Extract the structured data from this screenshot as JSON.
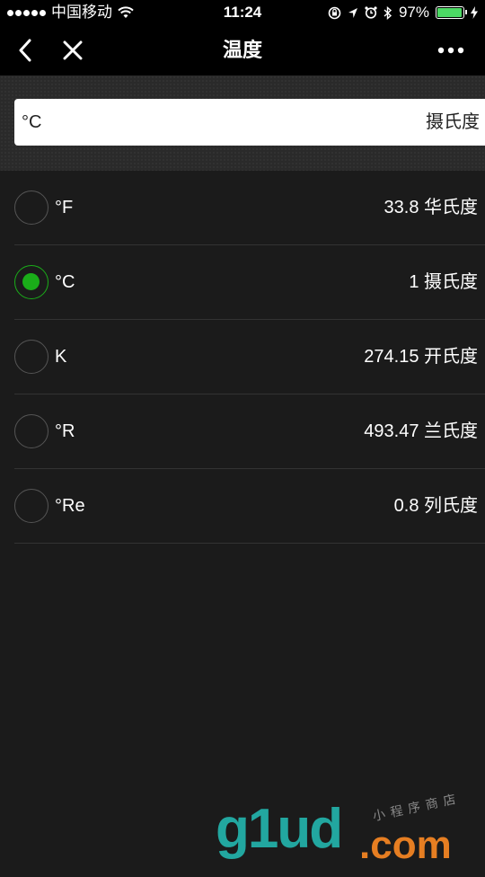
{
  "status_bar": {
    "carrier": "中国移动",
    "time": "11:24",
    "battery": "97%",
    "battery_level": 0.97,
    "icons": [
      "signal-dots-icon",
      "wifi-icon",
      "orientation-lock-icon",
      "location-icon",
      "alarm-icon",
      "bluetooth-icon",
      "battery-icon",
      "charging-icon"
    ]
  },
  "nav": {
    "title": "温度",
    "back_icon": "back-icon",
    "close_icon": "close-icon",
    "more_icon": "more-icon"
  },
  "input": {
    "unit": "°C",
    "unit_name": "摄氏度"
  },
  "units": [
    {
      "unit": "°F",
      "value": "33.8 华氏度",
      "selected": false
    },
    {
      "unit": "°C",
      "value": "1 摄氏度",
      "selected": true
    },
    {
      "unit": "K",
      "value": "274.15 开氏度",
      "selected": false
    },
    {
      "unit": "°R",
      "value": "493.47 兰氏度",
      "selected": false
    },
    {
      "unit": "°Re",
      "value": "0.8 列氏度",
      "selected": false
    }
  ],
  "colors": {
    "accent": "#1aad19",
    "background": "#1b1b1b",
    "bar": "#000000"
  },
  "watermark": {
    "main": "g1ud",
    "suffix": ".com",
    "tagline": "小程序商店"
  }
}
